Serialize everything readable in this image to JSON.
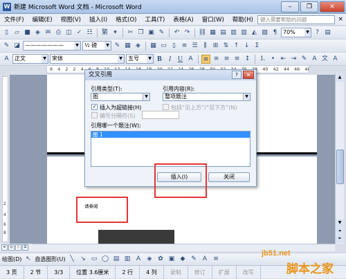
{
  "window": {
    "title": "新建 Microsoft Word 文档 - Microsoft Word",
    "app_icon": "W"
  },
  "menubar": {
    "items": [
      "文件(F)",
      "编辑(E)",
      "视图(V)",
      "插入(I)",
      "格式(O)",
      "工具(T)",
      "表格(A)",
      "窗口(W)",
      "帮助(H)"
    ],
    "help_placeholder": "键入需要帮助的问题",
    "close_glyph": "×"
  },
  "toolbar_standard": {
    "zoom": "70%",
    "pinyin_label": "繁"
  },
  "toolbar_format": {
    "style": "正文",
    "font": "宋体",
    "size": "五号",
    "bold": "B",
    "italic": "I",
    "underline": "U",
    "line_spacing_label": "½ 磅"
  },
  "ruler": {
    "ticks": [
      "6",
      "4",
      "2",
      "2",
      "4",
      "6",
      "8",
      "10",
      "12",
      "14",
      "16",
      "18",
      "20",
      "22",
      "24",
      "26",
      "28",
      "30",
      "32",
      "34",
      "36",
      "38",
      "40",
      "42",
      "44",
      "46",
      "48"
    ]
  },
  "vruler": {
    "ticks": [
      "2",
      "4",
      "6",
      "8",
      "10",
      "12"
    ]
  },
  "document": {
    "see_text": "请参阅"
  },
  "dialog": {
    "title": "交叉引用",
    "ref_type_label": "引用类型(T):",
    "ref_type_value": "图",
    "ref_content_label": "引用内容(R):",
    "ref_content_value": "整项题注",
    "insert_hyperlink_label": "插入为超链接(H)",
    "include_above_below_label": "包括“见上方”/“见下方”(N)",
    "separator_label": "编号分隔符(S)",
    "which_caption_label": "引用哪一个题注(W):",
    "captions": [
      "图 1"
    ],
    "insert_button": "插入(I)",
    "close_button": "关闭"
  },
  "drawbar": {
    "draw_label": "绘图(D)",
    "autoshape_label": "自选图形(U)"
  },
  "statusbar": {
    "page": "3 页",
    "section": "2 节",
    "page_of": "3/3",
    "position": "位置 3.6厘米",
    "line": "2 行",
    "column": "4 列",
    "rec": "录制",
    "trk": "修订",
    "ext": "扩展",
    "ovr": "改写"
  },
  "watermark": {
    "site": "jb51.net",
    "brand": "脚本之家"
  },
  "colors": {
    "highlight_box": "#e53333",
    "selection": "#3390ff",
    "title_gradient": "#a9c3e8"
  }
}
